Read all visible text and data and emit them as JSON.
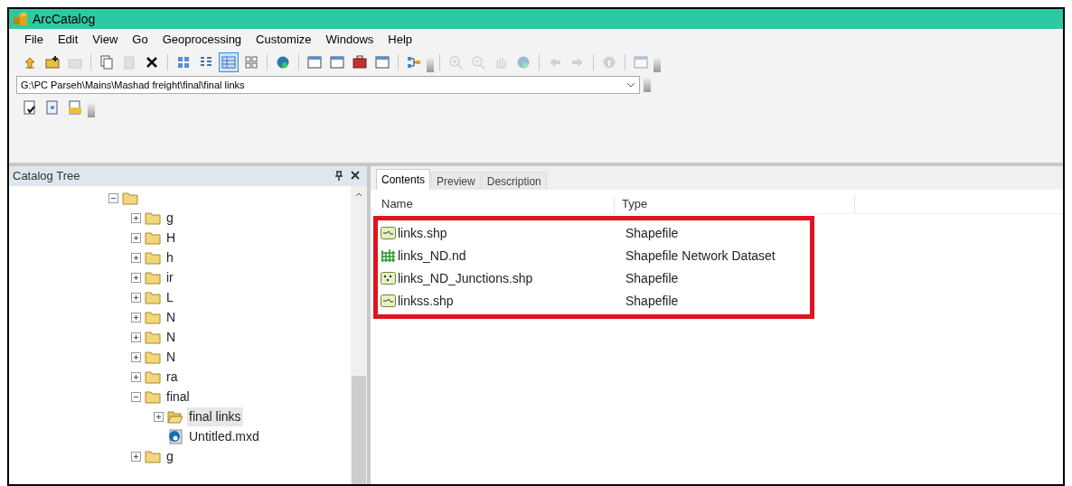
{
  "window": {
    "title": "ArcCatalog"
  },
  "menu": [
    "File",
    "Edit",
    "View",
    "Go",
    "Geoprocessing",
    "Customize",
    "Windows",
    "Help"
  ],
  "toolbar": [
    {
      "kind": "up",
      "disabled": false
    },
    {
      "kind": "connect",
      "disabled": false
    },
    {
      "kind": "disconnect",
      "disabled": true
    },
    {
      "kind": "sep"
    },
    {
      "kind": "copy",
      "disabled": false
    },
    {
      "kind": "paste",
      "disabled": true
    },
    {
      "kind": "delete",
      "disabled": false
    },
    {
      "kind": "sep"
    },
    {
      "kind": "large-icons",
      "disabled": false,
      "selected": false
    },
    {
      "kind": "list",
      "disabled": false,
      "selected": false
    },
    {
      "kind": "details",
      "disabled": false,
      "selected": true
    },
    {
      "kind": "thumbnails",
      "disabled": false,
      "selected": false
    },
    {
      "kind": "sep"
    },
    {
      "kind": "globe",
      "disabled": false
    },
    {
      "kind": "sep"
    },
    {
      "kind": "window",
      "disabled": false
    },
    {
      "kind": "window",
      "disabled": false
    },
    {
      "kind": "toolbox",
      "disabled": false
    },
    {
      "kind": "window",
      "disabled": false
    },
    {
      "kind": "sep"
    },
    {
      "kind": "model",
      "disabled": false
    },
    {
      "kind": "more"
    },
    {
      "kind": "sep"
    },
    {
      "kind": "zoom-in",
      "disabled": true
    },
    {
      "kind": "zoom-out",
      "disabled": true
    },
    {
      "kind": "pan",
      "disabled": true
    },
    {
      "kind": "globe",
      "disabled": true
    },
    {
      "kind": "sep"
    },
    {
      "kind": "back",
      "disabled": true
    },
    {
      "kind": "forward",
      "disabled": true
    },
    {
      "kind": "sep"
    },
    {
      "kind": "info",
      "disabled": true
    },
    {
      "kind": "sep"
    },
    {
      "kind": "window",
      "disabled": true
    },
    {
      "kind": "more"
    }
  ],
  "location": {
    "value": "G:\\PC Parseh\\Mains\\Mashad freight\\final\\final links"
  },
  "toolbar2": [
    {
      "kind": "check-doc",
      "disabled": false
    },
    {
      "kind": "doc",
      "disabled": false
    },
    {
      "kind": "folder-doc",
      "disabled": false
    },
    {
      "kind": "more"
    }
  ],
  "catalog_tree": {
    "title": "Catalog Tree",
    "items": [
      {
        "kind": "folder",
        "expanded": true,
        "children": [
          {
            "label": "g",
            "kind": "folder",
            "expanded": false
          },
          {
            "label": "H",
            "kind": "folder",
            "expanded": false
          },
          {
            "label": "h",
            "kind": "folder",
            "expanded": false
          },
          {
            "label": "ir",
            "kind": "folder",
            "expanded": false
          },
          {
            "label": "L",
            "kind": "folder",
            "expanded": false
          },
          {
            "label": "N",
            "kind": "folder",
            "expanded": false
          },
          {
            "label": "N",
            "kind": "folder",
            "expanded": false
          },
          {
            "label": "N",
            "kind": "folder",
            "expanded": false
          },
          {
            "label": "ra",
            "kind": "folder",
            "expanded": false
          },
          {
            "label": "final",
            "kind": "folder",
            "expanded": true,
            "children": [
              {
                "label": "final links",
                "kind": "open-folder",
                "expanded": false,
                "selected": true
              },
              {
                "label": "Untitled.mxd",
                "kind": "map",
                "selected": false
              }
            ]
          },
          {
            "label": "g",
            "kind": "folder",
            "expanded": false
          }
        ]
      }
    ]
  },
  "tabs": [
    {
      "label": "Contents",
      "selected": true
    },
    {
      "label": "Preview",
      "selected": false
    },
    {
      "label": "Description",
      "selected": false
    }
  ],
  "table": {
    "columns": [
      "Name",
      "Type"
    ],
    "rows": [
      {
        "kind": "line",
        "name": "links.shp",
        "type": "Shapefile"
      },
      {
        "kind": "network",
        "name": "links_ND.nd",
        "type": "Shapefile Network Dataset"
      },
      {
        "kind": "point",
        "name": "links_ND_Junctions.shp",
        "type": "Shapefile"
      },
      {
        "kind": "line",
        "name": "linkss.shp",
        "type": "Shapefile"
      }
    ]
  }
}
